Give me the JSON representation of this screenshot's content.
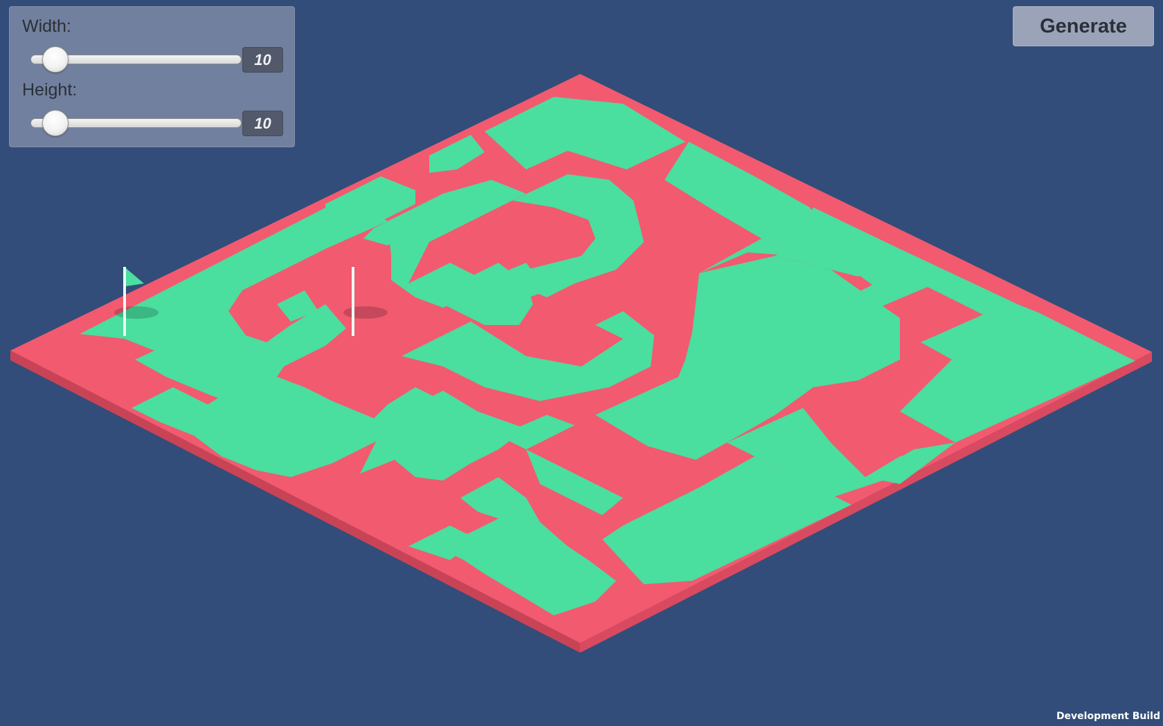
{
  "settings_panel": {
    "width_label": "Width:",
    "width_value": "10",
    "height_label": "Height:",
    "height_value": "10"
  },
  "generate_button": {
    "label": "Generate"
  },
  "footer": {
    "dev_build": "Development Build"
  },
  "maze": {
    "grid_width": 10,
    "grid_height": 10,
    "flags": [
      {
        "name": "start-flag",
        "color": "#4ade9f"
      },
      {
        "name": "goal-flag",
        "color": "#f25a6f"
      }
    ]
  },
  "colors": {
    "background": "#324d79",
    "wall_top": "#f25a6f",
    "wall_side": "#c94357",
    "path": "#4ade9f",
    "panel": "#71809e",
    "button": "#9aa3b7"
  },
  "icons": [
    "slider-thumb",
    "flag-icon"
  ]
}
